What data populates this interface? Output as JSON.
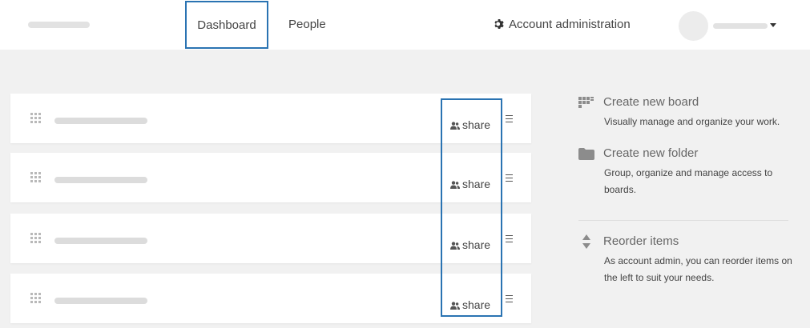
{
  "header": {
    "nav": {
      "dashboard": "Dashboard",
      "people": "People",
      "account_admin": "Account administration"
    },
    "icons": {
      "admin": "gear-icon",
      "user_menu": "caret-down-icon"
    }
  },
  "boards": [
    {
      "share_label": "share"
    },
    {
      "share_label": "share"
    },
    {
      "share_label": "share"
    },
    {
      "share_label": "share"
    }
  ],
  "help": {
    "create_board": {
      "title": "Create new board",
      "desc": "Visually manage and organize your work.",
      "icon": "board-icon"
    },
    "create_folder": {
      "title": "Create new folder",
      "desc": "Group, organize and manage access to boards.",
      "icon": "folder-icon"
    },
    "reorder": {
      "title": "Reorder items",
      "desc": "As account admin, you can reorder items on the left to suit your needs.",
      "icon": "reorder-icon"
    }
  },
  "colors": {
    "accent": "#2a73b2",
    "background": "#f1f1f1",
    "card": "#ffffff"
  }
}
